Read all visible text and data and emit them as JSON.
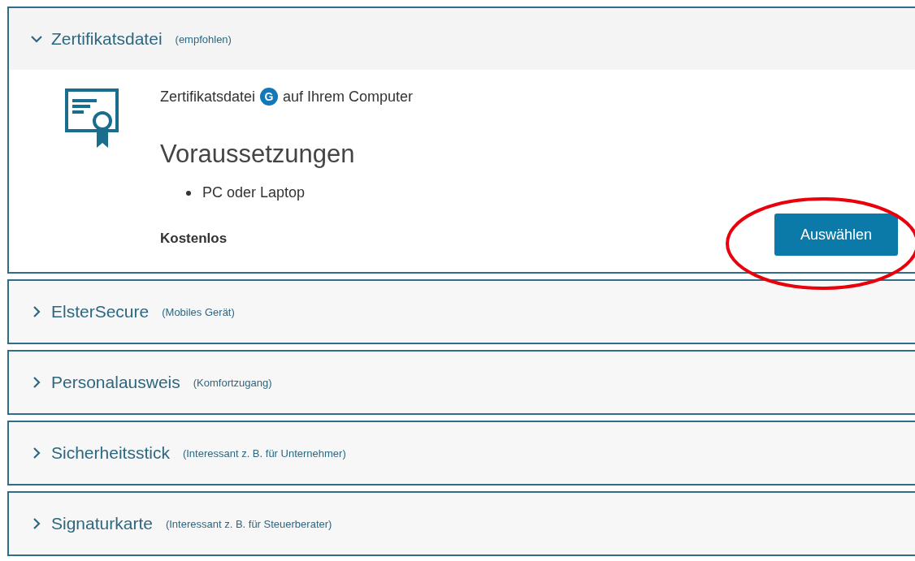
{
  "panels": [
    {
      "title": "Zertifikatsdatei",
      "note": "(empfohlen)",
      "expanded": true,
      "body": {
        "intro_before": "Zertifikatsdatei",
        "badge": "G",
        "intro_after": "auf Ihrem Computer",
        "heading": "Voraussetzungen",
        "requirements": [
          "PC oder Laptop"
        ],
        "price": "Kostenlos",
        "button": {
          "label": "Auswählen",
          "highlighted": true
        }
      }
    },
    {
      "title": "ElsterSecure",
      "note": "(Mobiles Gerät)",
      "expanded": false
    },
    {
      "title": "Personalausweis",
      "note": "(Komfortzugang)",
      "expanded": false
    },
    {
      "title": "Sicherheitsstick",
      "note": "(Interessant z. B. für Unternehmer)",
      "expanded": false
    },
    {
      "title": "Signaturkarte",
      "note": "(Interessant z. B. für Steuerberater)",
      "expanded": false
    }
  ]
}
